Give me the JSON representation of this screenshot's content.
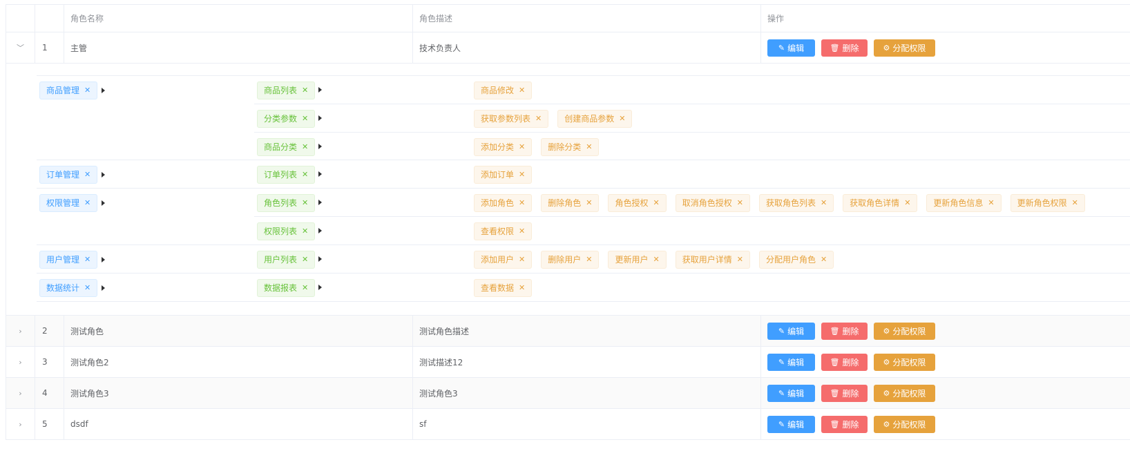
{
  "header": {
    "col_name": "角色名称",
    "col_desc": "角色描述",
    "col_ops": "操作"
  },
  "buttons": {
    "edit": "编辑",
    "delete": "删除",
    "assign": "分配权限"
  },
  "roles": [
    {
      "idx": "1",
      "name": "主管",
      "desc": "技术负责人"
    },
    {
      "idx": "2",
      "name": "测试角色",
      "desc": "测试角色描述"
    },
    {
      "idx": "3",
      "name": "测试角色2",
      "desc": "测试描述12"
    },
    {
      "idx": "4",
      "name": "测试角色3",
      "desc": "测试角色3"
    },
    {
      "idx": "5",
      "name": "dsdf",
      "desc": "sf"
    }
  ],
  "rights": [
    {
      "l1": "商品管理",
      "children": [
        {
          "l2": "商品列表",
          "l3": [
            "商品修改"
          ]
        },
        {
          "l2": "分类参数",
          "l3": [
            "获取参数列表",
            "创建商品参数"
          ]
        },
        {
          "l2": "商品分类",
          "l3": [
            "添加分类",
            "删除分类"
          ]
        }
      ]
    },
    {
      "l1": "订单管理",
      "children": [
        {
          "l2": "订单列表",
          "l3": [
            "添加订单"
          ]
        }
      ]
    },
    {
      "l1": "权限管理",
      "children": [
        {
          "l2": "角色列表",
          "l3": [
            "添加角色",
            "删除角色",
            "角色授权",
            "取消角色授权",
            "获取角色列表",
            "获取角色详情",
            "更新角色信息",
            "更新角色权限"
          ]
        },
        {
          "l2": "权限列表",
          "l3": [
            "查看权限"
          ]
        }
      ]
    },
    {
      "l1": "用户管理",
      "children": [
        {
          "l2": "用户列表",
          "l3": [
            "添加用户",
            "删除用户",
            "更新用户",
            "获取用户详情",
            "分配用户角色"
          ]
        }
      ]
    },
    {
      "l1": "数据统计",
      "children": [
        {
          "l2": "数据报表",
          "l3": [
            "查看数据"
          ]
        }
      ]
    }
  ],
  "icons": {
    "expand": "chevron-down-icon",
    "collapse": "chevron-right-icon",
    "edit": "pencil-icon",
    "delete": "trash-icon",
    "assign": "gear-icon",
    "tag_close": "close-icon"
  },
  "colors": {
    "primary": "#409eff",
    "danger": "#f56c6c",
    "warning": "#e6a23c",
    "success": "#67c23a"
  }
}
